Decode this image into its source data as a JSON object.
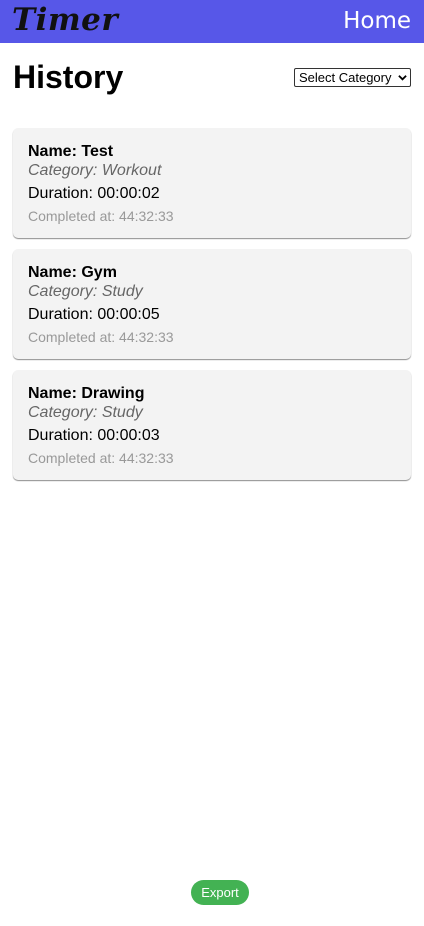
{
  "header": {
    "logo": "Timer",
    "nav_home": "Home",
    "brand_color": "#5757e8"
  },
  "main": {
    "title": "History",
    "category_select": {
      "selected": "Select Category"
    },
    "entries": [
      {
        "name": "Name: Test",
        "category": "Category: Workout",
        "duration": "Duration: 00:00:02",
        "completed": "Completed at: 44:32:33"
      },
      {
        "name": "Name: Gym",
        "category": "Category: Study",
        "duration": "Duration: 00:00:05",
        "completed": "Completed at: 44:32:33"
      },
      {
        "name": "Name: Drawing",
        "category": "Category: Study",
        "duration": "Duration: 00:00:03",
        "completed": "Completed at: 44:32:33"
      }
    ]
  },
  "footer": {
    "export_label": "Export",
    "export_color": "#43b253"
  }
}
